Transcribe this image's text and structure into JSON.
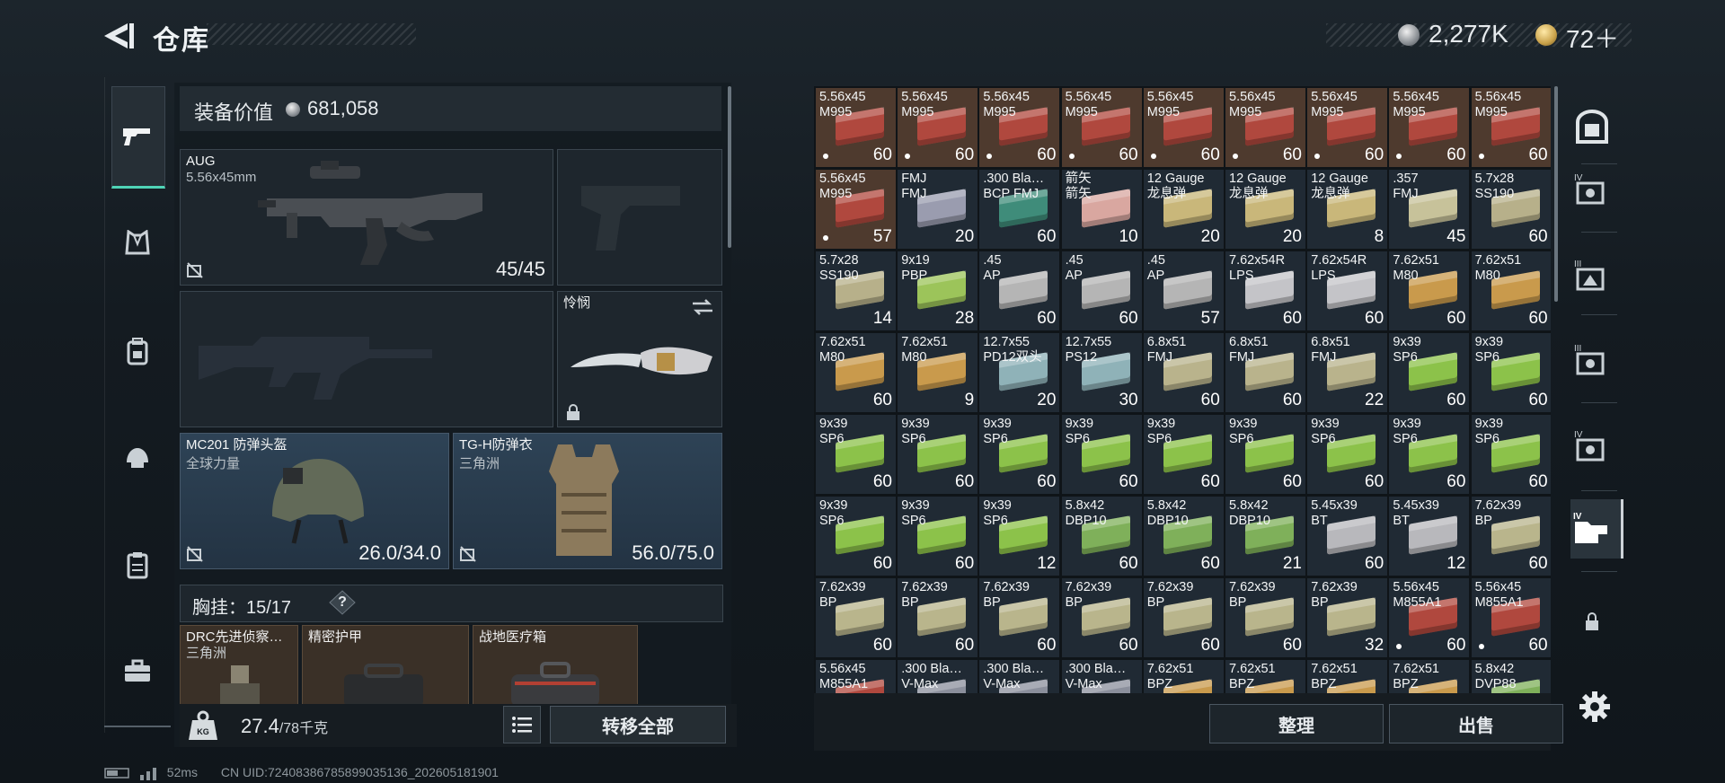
{
  "header": {
    "title": "仓库",
    "currencies": [
      {
        "icon": "silver-coin-icon",
        "value": "2,277K"
      },
      {
        "icon": "gold-token-icon",
        "value": "72＋"
      }
    ]
  },
  "tabs": [
    "weapon-tab-icon",
    "armor-tab-icon",
    "backpack-tab-icon",
    "helmet-tab-icon",
    "clipboard-tab-icon",
    "toolbox-tab-icon"
  ],
  "loadout": {
    "value_label": "装备价值",
    "value": "681,058",
    "primary": {
      "name": "AUG",
      "sub": "5.56x45mm",
      "durability": "45/45"
    },
    "melee": {
      "name": "怜悯"
    },
    "helmet": {
      "name": "MC201 防弹头盔",
      "sub": "全球力量",
      "durability": "26.0/34.0"
    },
    "armor": {
      "name": "TG-H防弹衣",
      "sub": "三角洲",
      "durability": "56.0/75.0"
    },
    "chest_label": "胸挂：",
    "chest_count": "15/17",
    "chest_help": "?",
    "chest_items": [
      {
        "name": "DRC先进侦察…",
        "sub": "三角洲"
      },
      {
        "name": "精密护甲",
        "sub": ""
      },
      {
        "name": "战地医疗箱",
        "sub": ""
      }
    ]
  },
  "footer": {
    "weight": "27.4",
    "weight_max": "/78千克",
    "transfer_all": "转移全部",
    "sort": "整理",
    "sell": "出售",
    "ping": "52ms",
    "uid": "CN UID:7240838678589903513​6_202605181901"
  },
  "ammo_grid": [
    {
      "l1": "5.56x45",
      "l2": "M995",
      "count": "60",
      "color": "#b0483e",
      "dot": true
    },
    {
      "l1": "5.56x45",
      "l2": "M995",
      "count": "60",
      "color": "#b0483e",
      "dot": true
    },
    {
      "l1": "5.56x45",
      "l2": "M995",
      "count": "60",
      "color": "#b0483e",
      "dot": true
    },
    {
      "l1": "5.56x45",
      "l2": "M995",
      "count": "60",
      "color": "#b0483e",
      "dot": true
    },
    {
      "l1": "5.56x45",
      "l2": "M995",
      "count": "60",
      "color": "#b0483e",
      "dot": true
    },
    {
      "l1": "5.56x45",
      "l2": "M995",
      "count": "60",
      "color": "#b0483e",
      "dot": true
    },
    {
      "l1": "5.56x45",
      "l2": "M995",
      "count": "60",
      "color": "#b0483e",
      "dot": true
    },
    {
      "l1": "5.56x45",
      "l2": "M995",
      "count": "60",
      "color": "#b0483e",
      "dot": true
    },
    {
      "l1": "5.56x45",
      "l2": "M995",
      "count": "60",
      "color": "#b0483e",
      "dot": true
    },
    {
      "l1": "5.56x45",
      "l2": "M995",
      "count": "57",
      "color": "#b0483e",
      "dot": true
    },
    {
      "l1": "FMJ",
      "l2": "FMJ",
      "count": "20",
      "color": "#9a9caf",
      "dot": false
    },
    {
      "l1": ".300 Bla…",
      "l2": "BCP FMJ",
      "count": "60",
      "color": "#3f8c7a",
      "dot": false
    },
    {
      "l1": "箭矢",
      "l2": "箭矢",
      "count": "10",
      "color": "#d9a7a0",
      "dot": false
    },
    {
      "l1": "12 Gauge",
      "l2": "龙息弹",
      "count": "20",
      "color": "#c9b77a",
      "dot": false
    },
    {
      "l1": "12 Gauge",
      "l2": "龙息弹",
      "count": "20",
      "color": "#c9b77a",
      "dot": false
    },
    {
      "l1": "12 Gauge",
      "l2": "龙息弹",
      "count": "8",
      "color": "#c9b77a",
      "dot": false
    },
    {
      "l1": ".357",
      "l2": "FMJ",
      "count": "45",
      "color": "#c7c29a",
      "dot": false
    },
    {
      "l1": "5.7x28",
      "l2": "SS190",
      "count": "60",
      "color": "#b7b08a",
      "dot": false
    },
    {
      "l1": "5.7x28",
      "l2": "SS190",
      "count": "14",
      "color": "#b7b08a",
      "dot": false
    },
    {
      "l1": "9x19",
      "l2": "PBP",
      "count": "28",
      "color": "#9cc45a",
      "dot": false
    },
    {
      "l1": ".45",
      "l2": "AP",
      "count": "60",
      "color": "#b5b5b5",
      "dot": false
    },
    {
      "l1": ".45",
      "l2": "AP",
      "count": "60",
      "color": "#b5b5b5",
      "dot": false
    },
    {
      "l1": ".45",
      "l2": "AP",
      "count": "57",
      "color": "#b5b5b5",
      "dot": false
    },
    {
      "l1": "7.62x54R",
      "l2": "LPS",
      "count": "60",
      "color": "#c4c4c8",
      "dot": false
    },
    {
      "l1": "7.62x54R",
      "l2": "LPS",
      "count": "60",
      "color": "#c4c4c8",
      "dot": false
    },
    {
      "l1": "7.62x51",
      "l2": "M80",
      "count": "60",
      "color": "#c99a4c",
      "dot": false
    },
    {
      "l1": "7.62x51",
      "l2": "M80",
      "count": "60",
      "color": "#c99a4c",
      "dot": false
    },
    {
      "l1": "7.62x51",
      "l2": "M80",
      "count": "60",
      "color": "#c99a4c",
      "dot": false
    },
    {
      "l1": "7.62x51",
      "l2": "M80",
      "count": "9",
      "color": "#c99a4c",
      "dot": false
    },
    {
      "l1": "12.7x55",
      "l2": "PD12双头",
      "count": "20",
      "color": "#8fb2b8",
      "dot": false
    },
    {
      "l1": "12.7x55",
      "l2": "PS12",
      "count": "30",
      "color": "#8fb2b8",
      "dot": false
    },
    {
      "l1": "6.8x51",
      "l2": "FMJ",
      "count": "60",
      "color": "#b9b38c",
      "dot": false
    },
    {
      "l1": "6.8x51",
      "l2": "FMJ",
      "count": "60",
      "color": "#b9b38c",
      "dot": false
    },
    {
      "l1": "6.8x51",
      "l2": "FMJ",
      "count": "22",
      "color": "#b9b38c",
      "dot": false
    },
    {
      "l1": "9x39",
      "l2": "SP6",
      "count": "60",
      "color": "#8cc24a",
      "dot": false
    },
    {
      "l1": "9x39",
      "l2": "SP6",
      "count": "60",
      "color": "#8cc24a",
      "dot": false
    },
    {
      "l1": "9x39",
      "l2": "SP6",
      "count": "60",
      "color": "#8cc24a",
      "dot": false
    },
    {
      "l1": "9x39",
      "l2": "SP6",
      "count": "60",
      "color": "#8cc24a",
      "dot": false
    },
    {
      "l1": "9x39",
      "l2": "SP6",
      "count": "60",
      "color": "#8cc24a",
      "dot": false
    },
    {
      "l1": "9x39",
      "l2": "SP6",
      "count": "60",
      "color": "#8cc24a",
      "dot": false
    },
    {
      "l1": "9x39",
      "l2": "SP6",
      "count": "60",
      "color": "#8cc24a",
      "dot": false
    },
    {
      "l1": "9x39",
      "l2": "SP6",
      "count": "60",
      "color": "#8cc24a",
      "dot": false
    },
    {
      "l1": "9x39",
      "l2": "SP6",
      "count": "60",
      "color": "#8cc24a",
      "dot": false
    },
    {
      "l1": "9x39",
      "l2": "SP6",
      "count": "60",
      "color": "#8cc24a",
      "dot": false
    },
    {
      "l1": "9x39",
      "l2": "SP6",
      "count": "60",
      "color": "#8cc24a",
      "dot": false
    },
    {
      "l1": "9x39",
      "l2": "SP6",
      "count": "60",
      "color": "#8cc24a",
      "dot": false
    },
    {
      "l1": "9x39",
      "l2": "SP6",
      "count": "60",
      "color": "#8cc24a",
      "dot": false
    },
    {
      "l1": "9x39",
      "l2": "SP6",
      "count": "12",
      "color": "#8cc24a",
      "dot": false
    },
    {
      "l1": "5.8x42",
      "l2": "DBP10",
      "count": "60",
      "color": "#7fb05a",
      "dot": false
    },
    {
      "l1": "5.8x42",
      "l2": "DBP10",
      "count": "60",
      "color": "#7fb05a",
      "dot": false
    },
    {
      "l1": "5.8x42",
      "l2": "DBP10",
      "count": "21",
      "color": "#7fb05a",
      "dot": false
    },
    {
      "l1": "5.45x39",
      "l2": "BT",
      "count": "60",
      "color": "#b8b8bc",
      "dot": false
    },
    {
      "l1": "5.45x39",
      "l2": "BT",
      "count": "12",
      "color": "#b8b8bc",
      "dot": false
    },
    {
      "l1": "7.62x39",
      "l2": "BP",
      "count": "60",
      "color": "#b9b58c",
      "dot": false
    },
    {
      "l1": "7.62x39",
      "l2": "BP",
      "count": "60",
      "color": "#b9b58c",
      "dot": false
    },
    {
      "l1": "7.62x39",
      "l2": "BP",
      "count": "60",
      "color": "#b9b58c",
      "dot": false
    },
    {
      "l1": "7.62x39",
      "l2": "BP",
      "count": "60",
      "color": "#b9b58c",
      "dot": false
    },
    {
      "l1": "7.62x39",
      "l2": "BP",
      "count": "60",
      "color": "#b9b58c",
      "dot": false
    },
    {
      "l1": "7.62x39",
      "l2": "BP",
      "count": "60",
      "color": "#b9b58c",
      "dot": false
    },
    {
      "l1": "7.62x39",
      "l2": "BP",
      "count": "60",
      "color": "#b9b58c",
      "dot": false
    },
    {
      "l1": "7.62x39",
      "l2": "BP",
      "count": "32",
      "color": "#b9b58c",
      "dot": false
    },
    {
      "l1": "5.56x45",
      "l2": "M855A1",
      "count": "60",
      "color": "#b0483e",
      "dot": true
    },
    {
      "l1": "5.56x45",
      "l2": "M855A1",
      "count": "60",
      "color": "#b0483e",
      "dot": true
    },
    {
      "l1": "5.56x45",
      "l2": "M855A1",
      "count": "",
      "color": "#b0483e",
      "dot": false
    },
    {
      "l1": ".300 Bla…",
      "l2": "V-Max",
      "count": "",
      "color": "#8b8f9c",
      "dot": false
    },
    {
      "l1": ".300 Bla…",
      "l2": "V-Max",
      "count": "",
      "color": "#8b8f9c",
      "dot": false
    },
    {
      "l1": ".300 Bla…",
      "l2": "V-Max",
      "count": "",
      "color": "#8b8f9c",
      "dot": false
    },
    {
      "l1": "7.62x51",
      "l2": "BPZ",
      "count": "",
      "color": "#c99a4c",
      "dot": false
    },
    {
      "l1": "7.62x51",
      "l2": "BPZ",
      "count": "",
      "color": "#c99a4c",
      "dot": false
    },
    {
      "l1": "7.62x51",
      "l2": "BPZ",
      "count": "",
      "color": "#c99a4c",
      "dot": false
    },
    {
      "l1": "7.62x51",
      "l2": "BPZ",
      "count": "",
      "color": "#c99a4c",
      "dot": false
    },
    {
      "l1": "5.8x42",
      "l2": "DVP88",
      "count": "",
      "color": "#7fb05a",
      "dot": false
    }
  ],
  "right_rail": [
    "safe-box-icon",
    "level4-case-icon",
    "level3-case-icon",
    "level3-case-icon",
    "level4-case-icon",
    "level4-folder-icon",
    "lock-icon"
  ]
}
